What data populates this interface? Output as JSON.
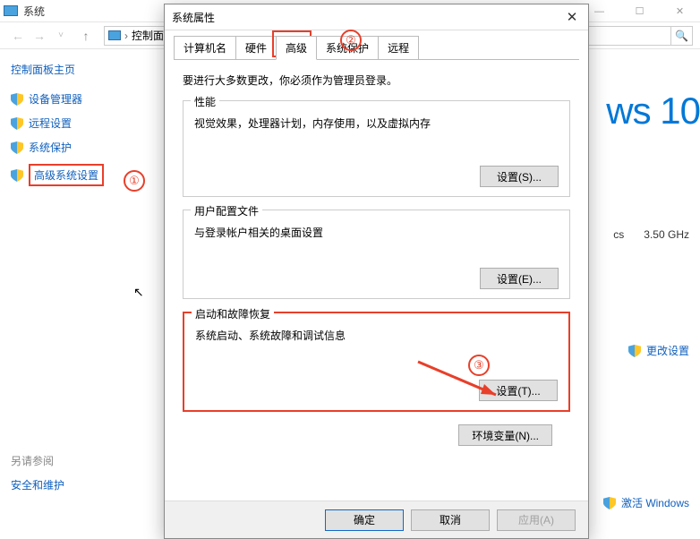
{
  "explorer": {
    "title": "系统",
    "breadcrumb": "控制面…",
    "sidebar": {
      "home": "控制面板主页",
      "items": [
        {
          "label": "设备管理器"
        },
        {
          "label": "远程设置"
        },
        {
          "label": "系统保护"
        },
        {
          "label": "高级系统设置"
        }
      ],
      "seeAlsoHeader": "另请参阅",
      "seeAlso": "安全和维护"
    },
    "rightBrand": "ws 10",
    "specs": {
      "cs": "cs",
      "ghz": "3.50 GHz"
    },
    "changeLink": "更改设置",
    "activate": "激活 Windows"
  },
  "dialog": {
    "title": "系统属性",
    "tabs": [
      "计算机名",
      "硬件",
      "高级",
      "系统保护",
      "远程"
    ],
    "intro": "要进行大多数更改，你必须作为管理员登录。",
    "perf": {
      "title": "性能",
      "desc": "视觉效果，处理器计划，内存使用，以及虚拟内存",
      "btn": "设置(S)..."
    },
    "profile": {
      "title": "用户配置文件",
      "desc": "与登录帐户相关的桌面设置",
      "btn": "设置(E)..."
    },
    "startup": {
      "title": "启动和故障恢复",
      "desc": "系统启动、系统故障和调试信息",
      "btn": "设置(T)..."
    },
    "envBtn": "环境变量(N)...",
    "ok": "确定",
    "cancel": "取消",
    "apply": "应用(A)"
  },
  "annotations": {
    "one": "①",
    "two": "②",
    "three": "③"
  }
}
